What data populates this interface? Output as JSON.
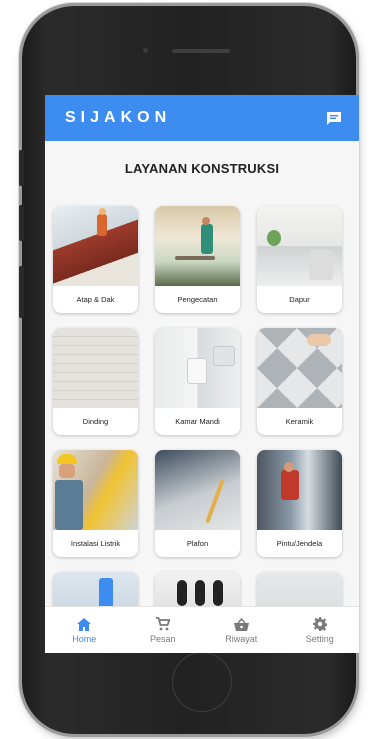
{
  "app": {
    "title": "SIJAKON"
  },
  "header": {
    "chat_icon": "chat-icon"
  },
  "section": {
    "title": "LAYANAN KONSTRUKSI"
  },
  "services": [
    {
      "label": "Atap & Dak",
      "image": "roof-worker"
    },
    {
      "label": "Pengecatan",
      "image": "painter"
    },
    {
      "label": "Dapur",
      "image": "kitchen"
    },
    {
      "label": "Dinding",
      "image": "brick-wall"
    },
    {
      "label": "Kamar Mandi",
      "image": "bathroom"
    },
    {
      "label": "Keramik",
      "image": "floor-tiles"
    },
    {
      "label": "Instalasi Listrik",
      "image": "electrician"
    },
    {
      "label": "Plafon",
      "image": "ceiling"
    },
    {
      "label": "Pintu/Jendela",
      "image": "window-installer"
    }
  ],
  "bottom_nav": {
    "items": [
      {
        "label": "Home",
        "icon": "home-icon",
        "active": true
      },
      {
        "label": "Pesan",
        "icon": "cart-icon",
        "active": false
      },
      {
        "label": "Riwayat",
        "icon": "basket-icon",
        "active": false
      },
      {
        "label": "Setting",
        "icon": "gear-icon",
        "active": false
      }
    ]
  },
  "colors": {
    "primary": "#3d8df1",
    "nav_inactive": "#7a7a7a"
  }
}
